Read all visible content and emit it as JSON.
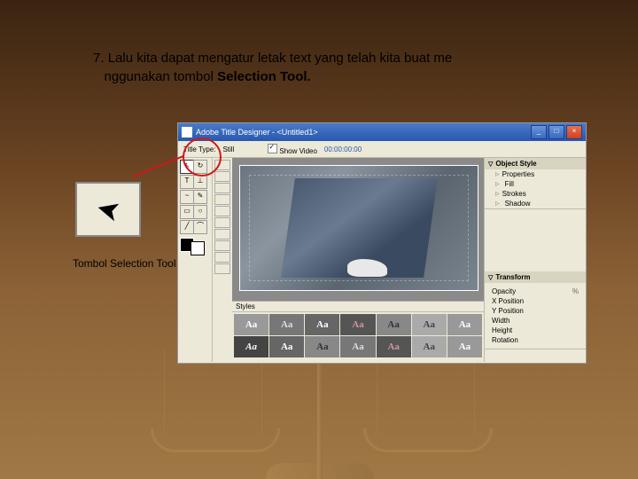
{
  "instruction": {
    "number": "7.",
    "line1": "Lalu kita dapat mengatur letak text yang telah kita buat me",
    "line2": "nggunakan tombol",
    "bold": "Selection Tool."
  },
  "caption": "Tombol Selection Tool",
  "window": {
    "title": "Adobe Title Designer - <Untitled1>",
    "min": "_",
    "max": "□",
    "close": "×"
  },
  "topbar": {
    "type_label": "Title Type:",
    "type_value": "Still",
    "show_video": "Show Video",
    "timecode": "00:00:00:00"
  },
  "right_panel": {
    "object_style": "Object Style",
    "properties": "Properties",
    "fill": "Fill",
    "strokes": "Strokes",
    "shadow": "Shadow",
    "transform": "Transform",
    "opacity_label": "Opacity",
    "opacity_val": "%",
    "xpos_label": "X Position",
    "xpos_val": "",
    "ypos_label": "Y Position",
    "ypos_val": "",
    "width_label": "Width",
    "width_val": "",
    "height_label": "Height",
    "height_val": "",
    "rotation_label": "Rotation",
    "rotation_val": ""
  },
  "styles": {
    "header": "Styles",
    "sample": "Aa"
  }
}
